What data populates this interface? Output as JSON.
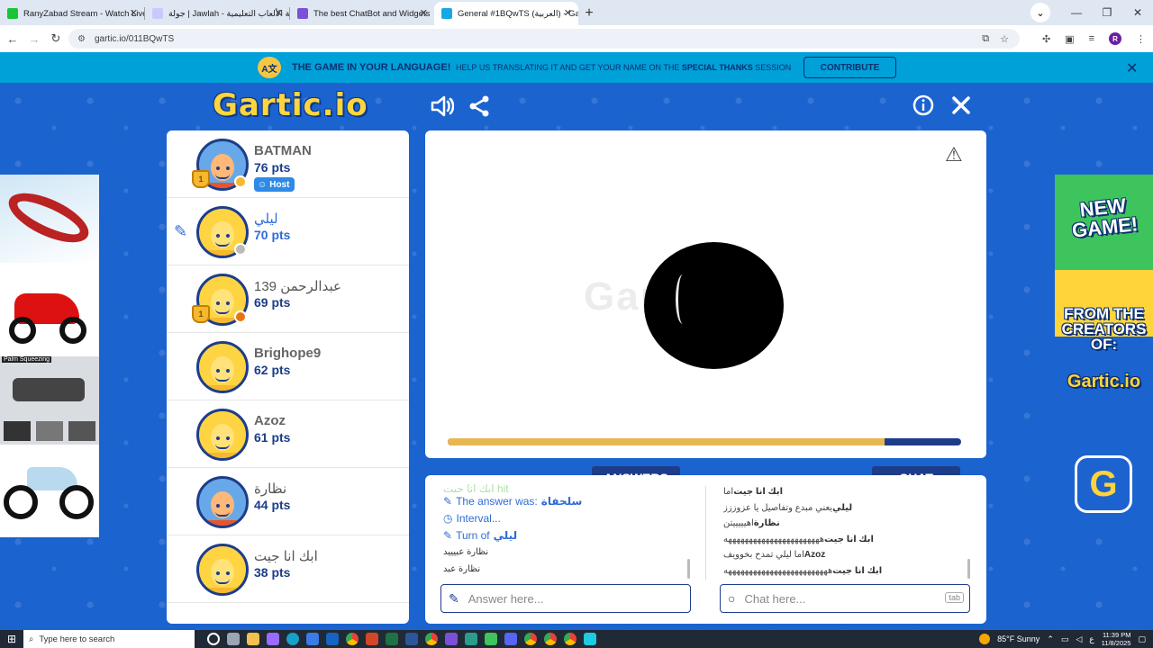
{
  "browser": {
    "tabs": [
      {
        "title": "RanyZabad Stream - Watch Live",
        "color": "#19c436"
      },
      {
        "title": "جولة | Jawlah - منصة الألعاب التعليمية",
        "color": "#c9c9ff"
      },
      {
        "title": "The best ChatBot and Widgets",
        "color": "#7b4fd8"
      },
      {
        "title": "General #1BQwTS (العربية) - Gartic",
        "color": "#17a8e3"
      }
    ],
    "url": "gartic.io/011BQwTS",
    "profile_initial": "R"
  },
  "banner": {
    "title": "THE GAME IN YOUR LANGUAGE!",
    "subtitle_pre": "HELP US TRANSLATING IT AND GET YOUR NAME ON THE",
    "subtitle_bold": "SPECIAL THANKS",
    "subtitle_post": "SESSION",
    "button": "CONTRIBUTE"
  },
  "game": {
    "logo": "Gartic.io",
    "canvas_watermark": "Gartic.io",
    "timer_fraction": 0.85,
    "players": [
      {
        "name": "BATMAN",
        "points": "76 pts",
        "host": true,
        "host_label": "Host",
        "trophy": true,
        "status_color": "#f5b82e",
        "avatar": "blue"
      },
      {
        "name": "ليلي",
        "points": "70 pts",
        "drawing": true,
        "status_color": "#bbbbbb",
        "avatar": "yellow",
        "current": true
      },
      {
        "name": "عبدالرحمن 139",
        "points": "69 pts",
        "trophy": true,
        "status_color": "#e8730f",
        "avatar": "yellow"
      },
      {
        "name": "Brighope9",
        "points": "62 pts",
        "avatar": "yellow"
      },
      {
        "name": "Azoz",
        "points": "61 pts",
        "avatar": "yellow"
      },
      {
        "name": "نظارة",
        "points": "44 pts",
        "avatar": "blue"
      },
      {
        "name": "ابك انا جيت",
        "points": "38 pts",
        "avatar": "yellow"
      }
    ],
    "answers_label": "ANSWERS",
    "chat_label": "CHAT",
    "answers": [
      {
        "text": "ابك انا جيت hit",
        "type": "faded"
      },
      {
        "text": "The answer was:",
        "highlight": "سلحفاة",
        "type": "sys"
      },
      {
        "text": "Interval...",
        "type": "sys-clock"
      },
      {
        "text": "Turn of",
        "highlight": "ليلي",
        "type": "sys"
      },
      {
        "text": "نظارة عبيييد",
        "type": "plain"
      },
      {
        "text": "نظارة عبد",
        "type": "plain"
      }
    ],
    "chat": [
      {
        "user": "ابك انا جيت",
        "text": "اما"
      },
      {
        "user": "ليلي",
        "text": "يعني مبدع وتفاصيل يا عزوززز"
      },
      {
        "user": "نظارة",
        "text": "اهيييييتن"
      },
      {
        "user": "ابك انا جيت",
        "text": "هههههههههههههههههههههههه"
      },
      {
        "user": "Azoz",
        "text": "اما ليلي تمدح بخوويف"
      },
      {
        "user": "ابك انا جيت",
        "text": "هههههههههههههههههههههههههه"
      }
    ],
    "answer_placeholder": "Answer here...",
    "chat_placeholder": "Chat here...",
    "tab_key": "tab"
  },
  "ads": {
    "right_new_game": "NEW GAME!",
    "right_from": "FROM THE CREATORS OF:",
    "right_brand": "Gartic.io",
    "left_caption": "Palm Squeezing"
  },
  "taskbar": {
    "search_placeholder": "Type here to search",
    "weather": "85°F  Sunny",
    "time": "11:39 PM",
    "date": "11/8/2025",
    "lang": "ع"
  }
}
